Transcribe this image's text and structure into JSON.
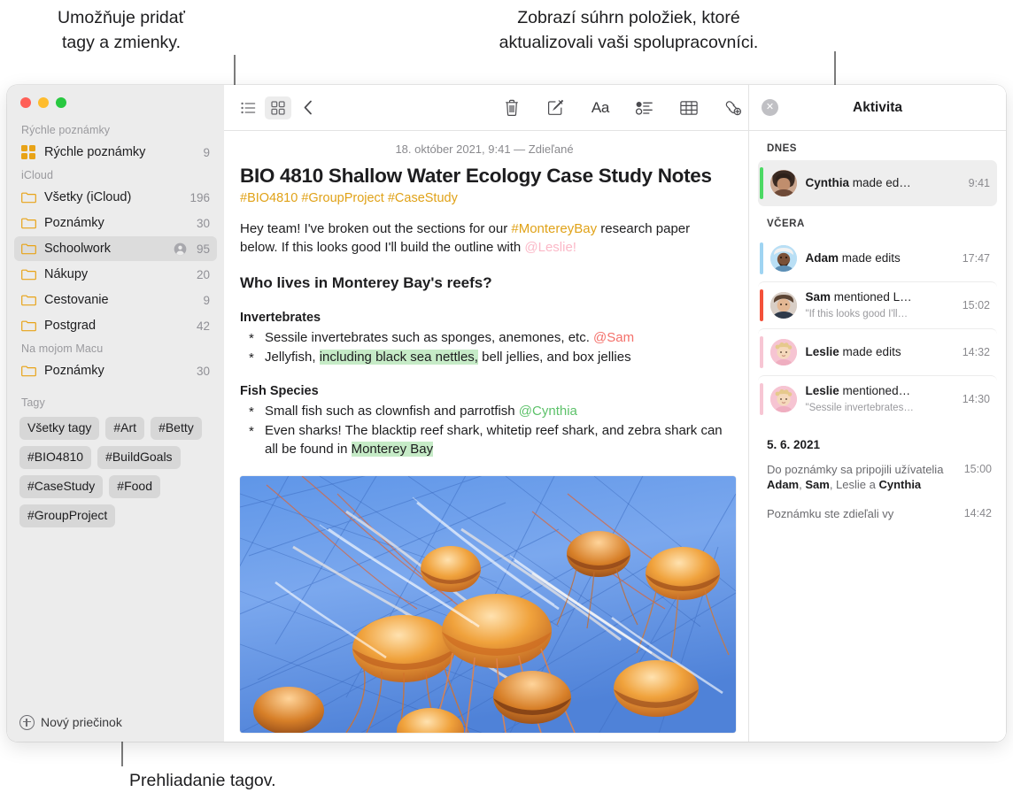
{
  "callouts": {
    "tags": "Umožňuje pridať\ntagy a zmienky.",
    "activity": "Zobrazí súhrn položiek, ktoré\naktualizovali vaši spolupracovníci.",
    "browse": "Prehliadanie tagov."
  },
  "sidebar": {
    "sections": [
      {
        "header": "Rýchle poznámky",
        "items": [
          {
            "icon": "quicknote-icon",
            "label": "Rýchle poznámky",
            "count": "9",
            "selected": false,
            "shared": false
          }
        ]
      },
      {
        "header": "iCloud",
        "items": [
          {
            "icon": "folder-icon",
            "label": "Všetky (iCloud)",
            "count": "196",
            "selected": false,
            "shared": false
          },
          {
            "icon": "folder-icon",
            "label": "Poznámky",
            "count": "30",
            "selected": false,
            "shared": false
          },
          {
            "icon": "folder-icon",
            "label": "Schoolwork",
            "count": "95",
            "selected": true,
            "shared": true
          },
          {
            "icon": "folder-icon",
            "label": "Nákupy",
            "count": "20",
            "selected": false,
            "shared": false
          },
          {
            "icon": "folder-icon",
            "label": "Cestovanie",
            "count": "9",
            "selected": false,
            "shared": false
          },
          {
            "icon": "folder-icon",
            "label": "Postgrad",
            "count": "42",
            "selected": false,
            "shared": false
          }
        ]
      },
      {
        "header": "Na mojom Macu",
        "items": [
          {
            "icon": "folder-icon",
            "label": "Poznámky",
            "count": "30",
            "selected": false,
            "shared": false
          }
        ]
      }
    ],
    "tags_header": "Tagy",
    "tags": [
      "Všetky tagy",
      "#Art",
      "#Betty",
      "#BIO4810",
      "#BuildGoals",
      "#CaseStudy",
      "#Food",
      "#GroupProject"
    ],
    "new_folder_label": "Nový priečinok"
  },
  "toolbar": {
    "list_view": "list-view-icon",
    "grid_view": "grid-view-icon",
    "back": "back-chevron-icon",
    "delete": "trash-icon",
    "compose": "compose-icon",
    "format": "Aa",
    "checklist": "checklist-icon",
    "table": "table-icon",
    "link": "link-add-icon",
    "lock": "lock-icon",
    "media": "media-icon",
    "collaborate": "collaborate-icon",
    "share": "share-icon",
    "search": "search-icon"
  },
  "note": {
    "date": "18. október 2021, 9:41 — Zdieľané",
    "title": "BIO 4810 Shallow Water Ecology Case Study Notes",
    "tags_line": "#BIO4810 #GroupProject #CaseStudy",
    "intro": {
      "part1": "Hey team! I've broken out the sections for our ",
      "hashtag": "#MontereyBay",
      "part2": " research paper below. If this looks good I'll build the outline with ",
      "mention": "@Leslie!"
    },
    "heading": "Who lives in Monterey Bay's reefs?",
    "sections": [
      {
        "subheading": "Invertebrates",
        "bullets": [
          {
            "pre": "Sessile invertebrates such as sponges, anemones, etc. ",
            "mention": "@Sam",
            "mention_color": "red",
            "post": "",
            "highlight": "",
            "tail": ""
          },
          {
            "pre": "Jellyfish, ",
            "mention": "",
            "mention_color": "",
            "highlight": "including black sea nettles,",
            "tail": " bell jellies, and box jellies"
          }
        ]
      },
      {
        "subheading": "Fish Species",
        "bullets": [
          {
            "pre": "Small fish such as clownfish and parrotfish ",
            "mention": "@Cynthia",
            "mention_color": "green",
            "highlight": "",
            "tail": ""
          },
          {
            "pre": "Even sharks! The blacktip reef shark, whitetip reef shark, and zebra shark can all be found in ",
            "mention": "",
            "mention_color": "",
            "highlight": "Monterey Bay",
            "tail": ""
          }
        ]
      }
    ],
    "image_alt": "jellyfish-photo"
  },
  "activity": {
    "title": "Aktivita",
    "close": "close-icon",
    "groups": [
      {
        "label": "DNES",
        "items": [
          {
            "name": "Cynthia",
            "action": " made ed…",
            "quote": "",
            "time": "9:41",
            "bar_color": "#4cd964",
            "avatar_bg": "#c9a896",
            "active": true
          }
        ]
      },
      {
        "label": "VČERA",
        "items": [
          {
            "name": "Adam",
            "action": " made edits",
            "quote": "",
            "time": "17:47",
            "bar_color": "#9fd4f2",
            "avatar_bg": "#b9dff5",
            "active": false
          },
          {
            "name": "Sam",
            "action": " mentioned L…",
            "quote": "\"If this looks good I'll…",
            "time": "15:02",
            "bar_color": "#f4513a",
            "avatar_bg": "#cfc0b4",
            "active": false
          },
          {
            "name": "Leslie",
            "action": " made edits",
            "quote": "",
            "time": "14:32",
            "bar_color": "#f7c6d4",
            "avatar_bg": "#f6c4d2",
            "active": false
          },
          {
            "name": "Leslie",
            "action": " mentioned…",
            "quote": "\"Sessile invertebrates…",
            "time": "14:30",
            "bar_color": "#f7c6d4",
            "avatar_bg": "#f6c4d2",
            "active": false
          }
        ]
      }
    ],
    "older": {
      "date": "5. 6. 2021",
      "entries": [
        {
          "text_pre": "Do poznámky sa pripojili užívatelia ",
          "bold1": "Adam",
          "mid1": ", ",
          "bold2": "Sam",
          "mid2": ", Leslie a ",
          "bold3": "Cynthia",
          "time": "15:00"
        },
        {
          "text_pre": "Poznámku ste zdieľali vy",
          "bold1": "",
          "mid1": "",
          "bold2": "",
          "mid2": "",
          "bold3": "",
          "time": "14:42"
        }
      ]
    }
  }
}
